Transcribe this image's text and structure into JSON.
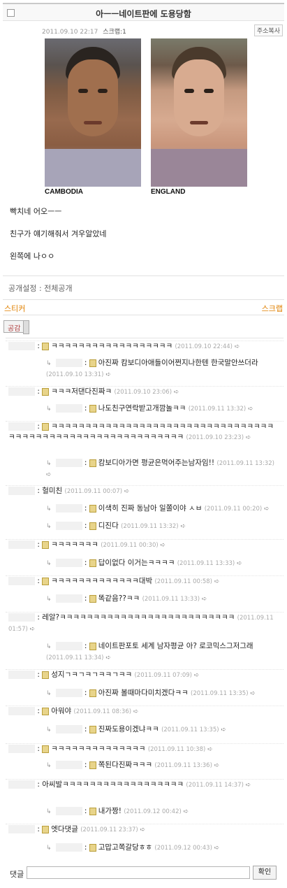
{
  "post": {
    "title": "아ㅡㅡ네이트판에 도용당함",
    "date": "2011.09.10 22:17",
    "scrap": "스크랩:1",
    "copy_url": "주소복사",
    "image_captions": [
      "CAMBODIA",
      "ENGLAND"
    ],
    "body": [
      "빡치네 어오ㅡㅡ",
      "친구가 얘기해줘서 겨우알았네",
      "왼쪽에 나ㅇㅇ"
    ],
    "privacy": "공개설정 : 전체공개",
    "sticker": "스티커",
    "scrap_link": "스크랩",
    "like_button": "공감"
  },
  "comments": [
    {
      "text": "ㅋㅋㅋㅋㅋㅋㅋㅋㅋㅋㅋㅋㅋㅋㅋㅋㅋㅋ",
      "date": "(2011.09.10 22:44)",
      "reply": false
    },
    {
      "text": "아진짜 캄보디아애들이어쩐지나한텐 한국말안쓰더라",
      "date": "(2011.09.10 13:31)",
      "reply": true
    },
    {
      "text": "ㅋㅋㅋ저댄다진짜ㅋ",
      "date": "(2011.09.10 23:06)",
      "reply": false
    },
    {
      "text": "나도친구연락받고개깜놀ㅋㅋ",
      "date": "(2011.09.11 13:32)",
      "reply": true
    },
    {
      "text": "ㅋㅋㅋㅋㅋㅋㅋㅋㅋㅋㅋㅋㅋㅋㅋㅋㅋㅋㅋㅋㅋㅋㅋㅋㅋㅋㅋㅋㅋㅋㅋㅋㅋㅋㅋㅋㅋㅋㅋㅋㅋㅋㅋㅋㅋㅋㅋㅋㅋㅋㅋㅋㅋㅋㅋㅋㅋㅋㅋ",
      "date": "(2011.09.10 23:23)",
      "reply": false
    },
    {
      "text": "캄보디아가면 평균은먹어주는남자임!!",
      "date": "(2011.09.11 13:32)",
      "reply": true
    },
    {
      "text": "헐미친",
      "date": "(2011.09.11 00:07)",
      "reply": false
    },
    {
      "text": "이색히 진짜 동남아 일쫄이야 ㅅㅂ",
      "date": "(2011.09.11 00:20)",
      "reply": true
    },
    {
      "text": "디진다",
      "date": "(2011.09.11 13:32)",
      "reply": true
    },
    {
      "text": "ㅋㅋㅋㅋㅋㅋㅋ",
      "date": "(2011.09.11 00:30)",
      "reply": false
    },
    {
      "text": "답이없다 이거는ㅋㅋㅋㅋ",
      "date": "(2011.09.11 13:33)",
      "reply": true
    },
    {
      "text": "ㅋㅋㅋㅋㅋㅋㅋㅋㅋㅋㅋㅋㅋ대박",
      "date": "(2011.09.11 00:58)",
      "reply": false
    },
    {
      "text": "똑같음??ㅋㅋ",
      "date": "(2011.09.11 13:33)",
      "reply": true
    },
    {
      "text": "레알?ㅋㅋㅋㅋㅋㅋㅋㅋㅋㅋㅋㅋㅋㅋㅋㅋㅋㅋㅋㅋㅋㅋㅋㅋㅋㅋ",
      "date": "(2011.09.11 01:57)",
      "reply": false
    },
    {
      "text": "네이트판포토 세계 남자평균 아? 로코믹스그저그래",
      "date": "(2011.09.11 13:34)",
      "reply": true
    },
    {
      "text": "성지ㄱㅋㄱㅋㄱㅋㅋㄱㅋㅋ",
      "date": "(2011.09.11 07:09)",
      "reply": false
    },
    {
      "text": "아진짜 볼때마다미치겠다ㅋㅋ",
      "date": "(2011.09.11 13:35)",
      "reply": true
    },
    {
      "text": "아워야",
      "date": "(2011.09.11 08:36)",
      "reply": false
    },
    {
      "text": "진짜도용이겠냐ㅋㅋ",
      "date": "(2011.09.11 13:35)",
      "reply": true
    },
    {
      "text": "ㅋㅋㅋㅋㅋㅋㅋㅋㅋㅋㅋㅋㅋㅋ",
      "date": "(2011.09.11 10:38)",
      "reply": false
    },
    {
      "text": "쪽된다진짜ㅋㅋㅋ",
      "date": "(2011.09.11 13:36)",
      "reply": true
    },
    {
      "text": "아씨발ㅋㅋㅋㅋㅋㅋㅋㅋㅋㅋㅋㅋㅋㅋㅋㅋㅋㅋ",
      "date": "(2011.09.11 14:37)",
      "reply": false
    },
    {
      "text": "내가짱!",
      "date": "(2011.09.12 00:42)",
      "reply": true
    },
    {
      "text": "엣다댓글",
      "date": "(2011.09.11 23:37)",
      "reply": false
    },
    {
      "text": "고맙고쪽갈당ㅎㅎ",
      "date": "(2011.09.12 00:43)",
      "reply": true
    }
  ],
  "reply_bar": {
    "label": "댓글",
    "input_value": "",
    "submit": "확인"
  },
  "icons": {
    "checkbox": "checkbox-icon",
    "arrow": "reply-arrow-icon",
    "sticker": "sticker-icon"
  }
}
